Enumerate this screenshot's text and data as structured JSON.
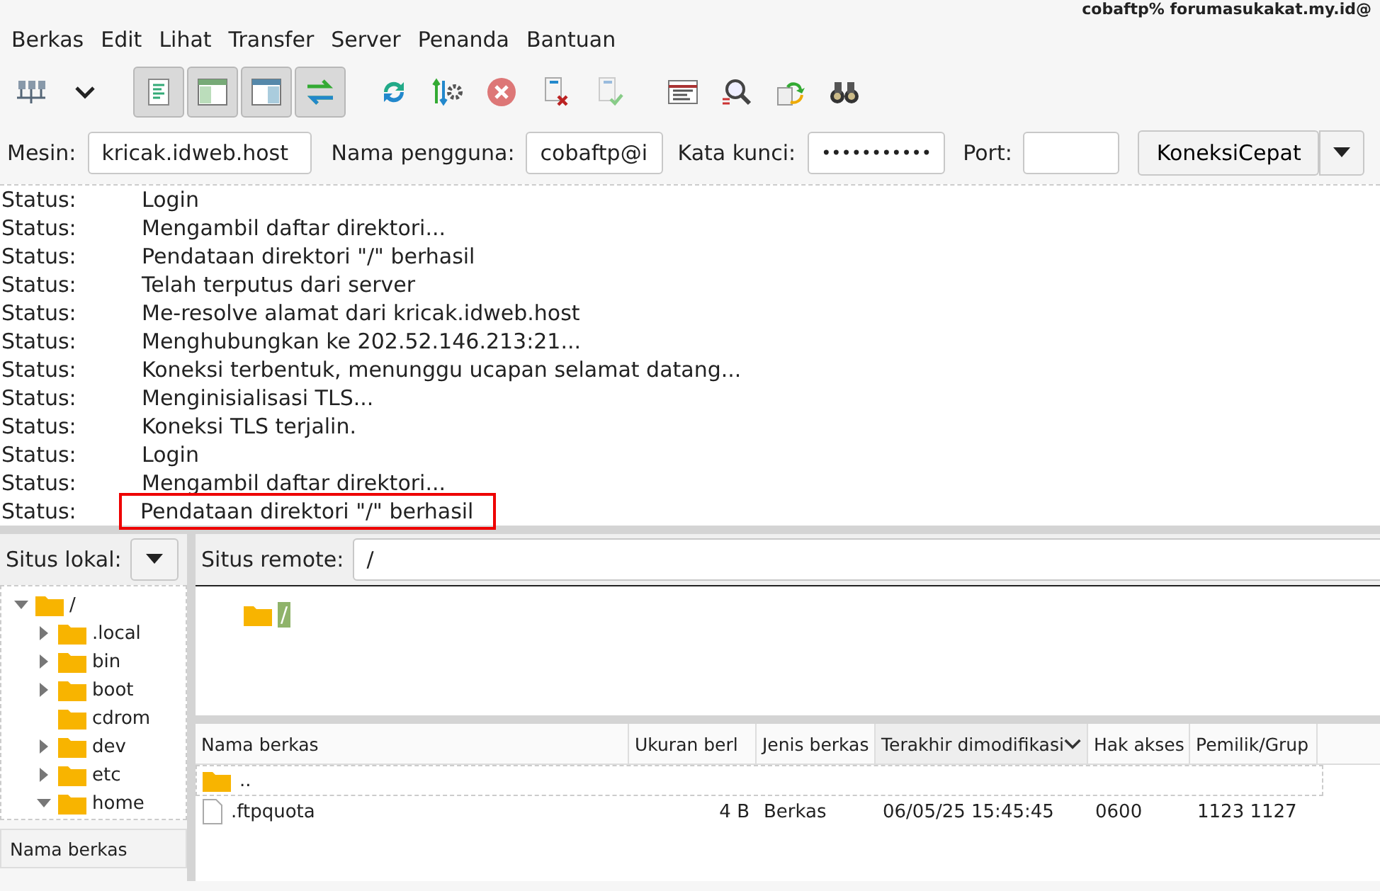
{
  "window": {
    "title": "cobaftp% forumasukakat.my.id@"
  },
  "menu": [
    "Berkas",
    "Edit",
    "Lihat",
    "Transfer",
    "Server",
    "Penanda",
    "Bantuan"
  ],
  "toolbar": [
    {
      "kind": "sitemanager",
      "pressed": false
    },
    {
      "kind": "dropdown",
      "pressed": false
    },
    {
      "kind": "log",
      "pressed": true
    },
    {
      "kind": "localtree",
      "pressed": true
    },
    {
      "kind": "remotetree",
      "pressed": true
    },
    {
      "kind": "queue",
      "pressed": true
    },
    {
      "kind": "refresh",
      "pressed": false
    },
    {
      "kind": "process",
      "pressed": false
    },
    {
      "kind": "cancel",
      "pressed": false
    },
    {
      "kind": "disconnect",
      "pressed": false
    },
    {
      "kind": "reconnect",
      "pressed": false
    },
    {
      "kind": "filter",
      "pressed": false
    },
    {
      "kind": "compare",
      "pressed": false
    },
    {
      "kind": "sync",
      "pressed": false
    },
    {
      "kind": "find",
      "pressed": false
    }
  ],
  "quickconnect": {
    "host_label": "Mesin:",
    "host": "kricak.idweb.host",
    "user_label": "Nama pengguna:",
    "user": "cobaftp@i",
    "pass_label": "Kata kunci:",
    "pass": "•••••••••••",
    "port_label": "Port:",
    "button": "KoneksiCepat"
  },
  "log": [
    {
      "type": "Status:",
      "message": "Login",
      "highlighted": false
    },
    {
      "type": "Status:",
      "message": "Mengambil daftar direktori...",
      "highlighted": false
    },
    {
      "type": "Status:",
      "message": "Pendataan direktori \"/\" berhasil",
      "highlighted": false
    },
    {
      "type": "Status:",
      "message": "Telah terputus dari server",
      "highlighted": false
    },
    {
      "type": "Status:",
      "message": "Me-resolve alamat dari kricak.idweb.host",
      "highlighted": false
    },
    {
      "type": "Status:",
      "message": "Menghubungkan ke 202.52.146.213:21...",
      "highlighted": false
    },
    {
      "type": "Status:",
      "message": "Koneksi terbentuk, menunggu ucapan selamat datang...",
      "highlighted": false
    },
    {
      "type": "Status:",
      "message": "Menginisialisasi TLS...",
      "highlighted": false
    },
    {
      "type": "Status:",
      "message": "Koneksi TLS terjalin.",
      "highlighted": false
    },
    {
      "type": "Status:",
      "message": "Login",
      "highlighted": false
    },
    {
      "type": "Status:",
      "message": "Mengambil daftar direktori...",
      "highlighted": false
    },
    {
      "type": "Status:",
      "message": "Pendataan direktori \"/\" berhasil",
      "highlighted": true
    }
  ],
  "local": {
    "label": "Situs lokal:",
    "tree": [
      {
        "name": "/",
        "expandable": true,
        "expanded": true,
        "children": [
          {
            "name": ".local",
            "expandable": true,
            "expanded": false
          },
          {
            "name": "bin",
            "expandable": true,
            "expanded": false
          },
          {
            "name": "boot",
            "expandable": true,
            "expanded": false
          },
          {
            "name": "cdrom",
            "expandable": false
          },
          {
            "name": "dev",
            "expandable": true,
            "expanded": false
          },
          {
            "name": "etc",
            "expandable": true,
            "expanded": false
          },
          {
            "name": "home",
            "expandable": true,
            "expanded": true
          }
        ]
      }
    ],
    "list_header": "Nama berkas"
  },
  "remote": {
    "label": "Situs remote:",
    "path": "/",
    "tree": [
      {
        "name": "/",
        "selected": true
      }
    ],
    "columns": [
      {
        "label": "Nama berkas",
        "sorted": false
      },
      {
        "label": "Ukuran berl",
        "sorted": false
      },
      {
        "label": "Jenis berkas",
        "sorted": false
      },
      {
        "label": "Terakhir dimodifikasi",
        "sorted": true
      },
      {
        "label": "Hak akses",
        "sorted": false
      },
      {
        "label": "Pemilik/Grup",
        "sorted": false
      }
    ],
    "rows": [
      {
        "kind": "folder",
        "cells": [
          "..",
          "",
          "",
          "",
          "",
          ""
        ]
      },
      {
        "kind": "file",
        "cells": [
          ".ftpquota",
          "4 B",
          "Berkas",
          "06/05/25 15:45:45",
          "0600",
          "1123 1127"
        ]
      }
    ]
  }
}
